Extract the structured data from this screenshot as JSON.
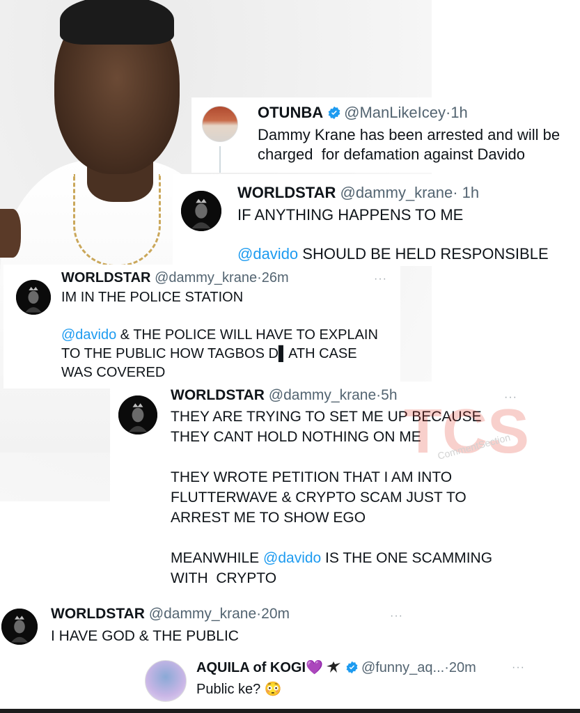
{
  "tweets": [
    {
      "name": "OTUNBA",
      "handle": "@ManLikeIcey",
      "sep": "·",
      "time": "1h",
      "verified": true,
      "line1": "Dammy Krane has been arrested and will be",
      "line2": "charged  for defamation against Davido"
    },
    {
      "name": "WORLDSTAR",
      "handle": "@dammy_krane",
      "sep": "·",
      "time": "1h",
      "line1": "IF ANYTHING HAPPENS TO ME",
      "mention": "@davido",
      "line2_rest": " SHOULD BE HELD RESPONSIBLE"
    },
    {
      "name": "WORLDSTAR",
      "handle": "@dammy_krane",
      "sep": "·",
      "time": "26m",
      "more": "···",
      "line1": "IM IN THE POLICE STATION",
      "mention": "@davido",
      "line2_rest": " & THE POLICE WILL HAVE TO EXPLAIN",
      "line3": "TO THE PUBLIC HOW TAGBOS D▌ATH CASE",
      "line4": "WAS COVERED"
    },
    {
      "name": "WORLDSTAR",
      "handle": "@dammy_krane",
      "sep": "·",
      "time": "5h",
      "more": "···",
      "line1": "THEY ARE TRYING TO SET ME UP BECAUSE",
      "line2": "THEY CANT HOLD NOTHING ON ME",
      "line3": "THEY WROTE PETITION THAT I AM INTO",
      "line4": "FLUTTERWAVE & CRYPTO SCAM JUST TO",
      "line5": "ARREST ME TO SHOW EGO",
      "line6_pre": "MEANWHILE ",
      "mention": "@davido",
      "line6_rest": " IS THE ONE SCAMMING",
      "line7": "WITH  CRYPTO"
    },
    {
      "name": "WORLDSTAR",
      "handle": "@dammy_krane",
      "sep": "·",
      "time": "20m",
      "more": "···",
      "line1": "I HAVE GOD & THE PUBLIC"
    },
    {
      "name": "AQUILA of KOGI",
      "emoji": "💜",
      "handle": "@funny_aq...",
      "sep": "·",
      "time": "20m",
      "verified": true,
      "more": "···",
      "line1": "Public ke? 😳"
    }
  ],
  "watermark": {
    "logo": "TCS",
    "text": "CommentSection"
  },
  "colors": {
    "mention": "#1d9bf0",
    "verified": "#1d9bf0",
    "muted": "#536471"
  }
}
